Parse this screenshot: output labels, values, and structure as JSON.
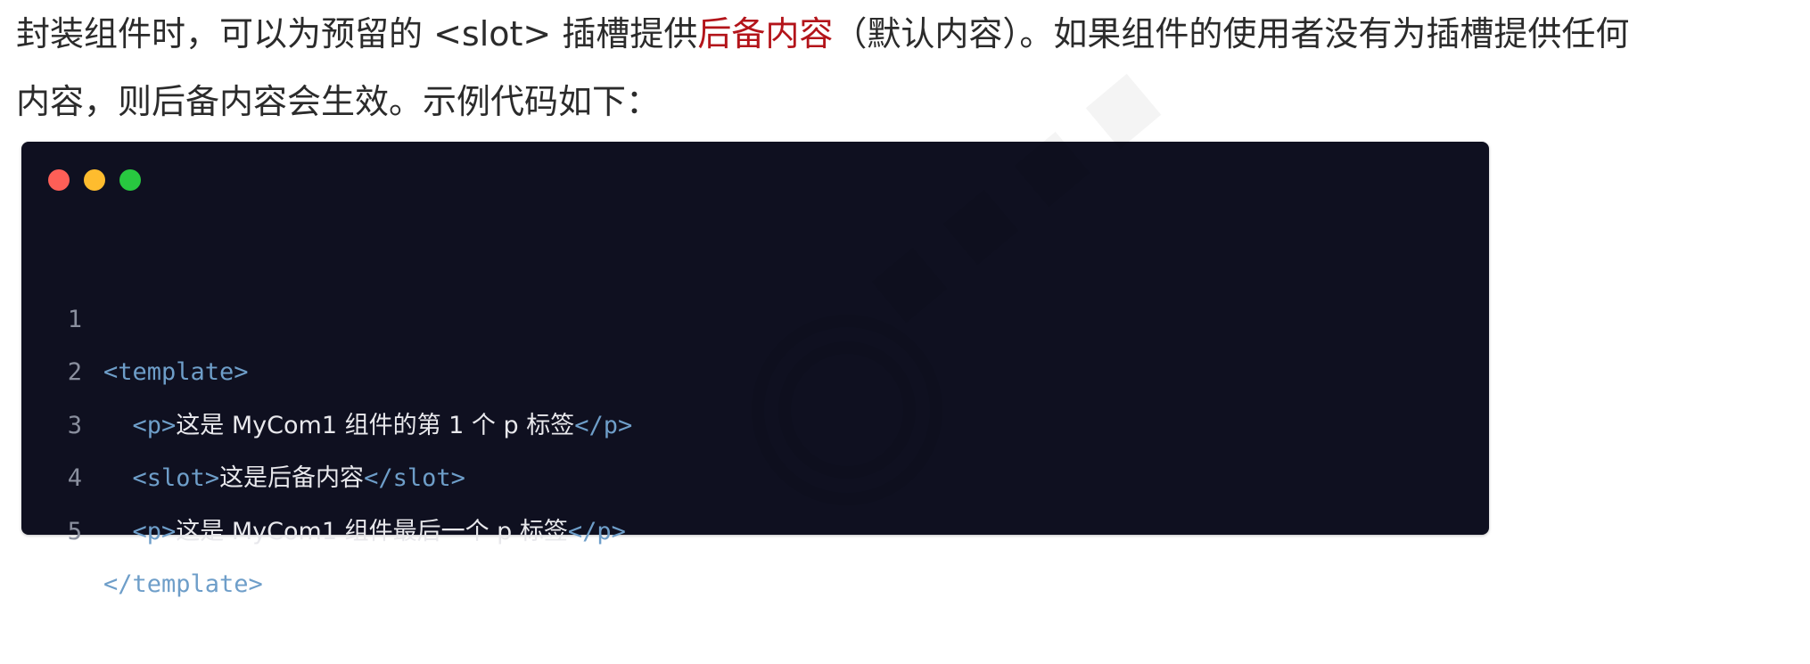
{
  "paragraph": {
    "line1_before": "封装组件时，可以为预留的 <slot> 插槽提供",
    "line1_highlight": "后备内容",
    "line1_after": "（默认内容）。如果组件的使用者没有为插槽提供任何",
    "line2": "内容，则后备内容会生效。示例代码如下："
  },
  "code_window": {
    "lines": [
      {
        "num": "1",
        "open": "<template>",
        "text": "",
        "close": ""
      },
      {
        "num": "2",
        "open": "<p>",
        "text": "这是 MyCom1 组件的第 1 个 p 标签",
        "close": "</p>"
      },
      {
        "num": "3",
        "open": "<slot>",
        "text": "这是后备内容",
        "close": "</slot>"
      },
      {
        "num": "4",
        "open": "<p>",
        "text": "这是 MyCom1 组件最后一个 p 标签",
        "close": "</p>"
      },
      {
        "num": "5",
        "open": "</template>",
        "text": "",
        "close": ""
      }
    ]
  },
  "colors": {
    "highlight": "#b3141a",
    "code_background": "#0f1020",
    "tag": "#6e9ec9",
    "dot_red": "#fe5f57",
    "dot_yellow": "#febc2e",
    "dot_green": "#28c840"
  }
}
